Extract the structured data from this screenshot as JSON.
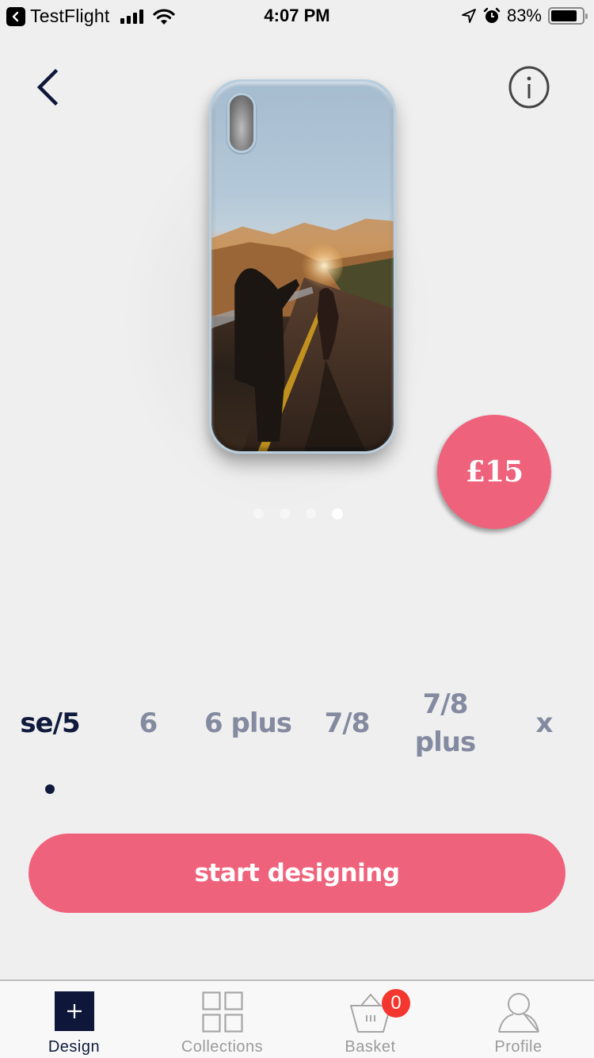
{
  "status_bar": {
    "back_app": "TestFlight",
    "time": "4:07 PM",
    "battery_percent_label": "83%",
    "battery_level": 0.83,
    "icons": [
      "back-to-app-icon",
      "cellular-signal-icon",
      "wifi-icon",
      "location-arrow-icon",
      "alarm-icon",
      "battery-icon"
    ]
  },
  "header": {
    "back_icon": "chevron-left-icon",
    "info_icon": "info-circle-icon"
  },
  "product": {
    "image_description": "Phone case with photo of two people walking on a road at sunset",
    "price": "£15",
    "pager": {
      "count": 4,
      "active_index": 3
    }
  },
  "models": {
    "items": [
      {
        "label": "se/5",
        "active": true
      },
      {
        "label": "6",
        "active": false
      },
      {
        "label": "6 plus",
        "active": false
      },
      {
        "label": "7/8",
        "active": false
      },
      {
        "label": "7/8 plus",
        "active": false
      },
      {
        "label": "x",
        "active": false
      }
    ]
  },
  "cta": {
    "label": "start designing"
  },
  "tab_bar": {
    "items": [
      {
        "label": "Design",
        "icon": "plus-square-icon",
        "active": true
      },
      {
        "label": "Collections",
        "icon": "grid-icon",
        "active": false
      },
      {
        "label": "Basket",
        "icon": "basket-icon",
        "active": false,
        "badge": "0"
      },
      {
        "label": "Profile",
        "icon": "person-icon",
        "active": false
      }
    ]
  },
  "colors": {
    "accent": "#ef627c",
    "navy": "#101a3d",
    "inactive_tab": "#848ba0",
    "badge": "#f3372f"
  }
}
